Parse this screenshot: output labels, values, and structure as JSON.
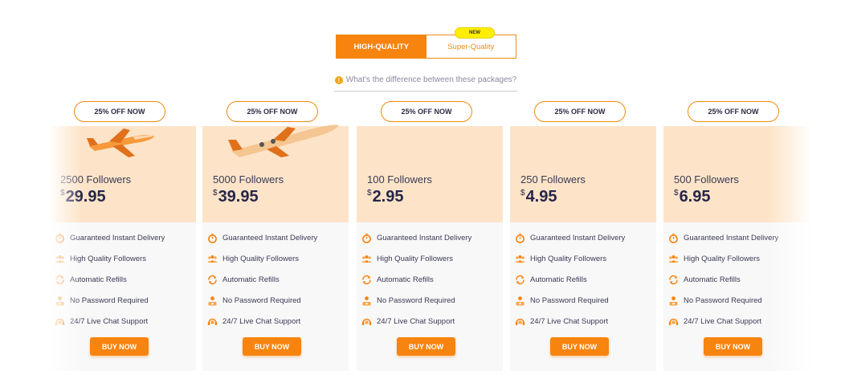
{
  "toggle": {
    "option_active": "HIGH-QUALITY",
    "option_other": "Super-Quality",
    "new_badge": "NEW"
  },
  "diff_link": {
    "icon": "info-icon",
    "text": "What's the difference between these packages?"
  },
  "colors": {
    "accent": "#f7840f",
    "card_top": "#fde4c8",
    "card_bottom": "#f8f8f9",
    "new_badge": "#ffee00"
  },
  "features": [
    {
      "icon": "stopwatch-icon",
      "label": "Guaranteed Instant Delivery"
    },
    {
      "icon": "people-icon",
      "label": "High Quality Followers"
    },
    {
      "icon": "refresh-icon",
      "label": "Automatic Refills"
    },
    {
      "icon": "user-lock-icon",
      "label": "No Password Required"
    },
    {
      "icon": "headset-icon",
      "label": "24/7 Live Chat Support"
    }
  ],
  "plans": [
    {
      "badge": "25% OFF NOW",
      "followers": "2500 Followers",
      "currency": "$",
      "price": "29.95",
      "buy": "BUY NOW"
    },
    {
      "badge": "25% OFF NOW",
      "followers": "5000 Followers",
      "currency": "$",
      "price": "39.95",
      "buy": "BUY NOW"
    },
    {
      "badge": "25% OFF NOW",
      "followers": "100 Followers",
      "currency": "$",
      "price": "2.95",
      "buy": "BUY NOW"
    },
    {
      "badge": "25% OFF NOW",
      "followers": "250 Followers",
      "currency": "$",
      "price": "4.95",
      "buy": "BUY NOW"
    },
    {
      "badge": "25% OFF NOW",
      "followers": "500 Followers",
      "currency": "$",
      "price": "6.95",
      "buy": "BUY NOW"
    }
  ]
}
